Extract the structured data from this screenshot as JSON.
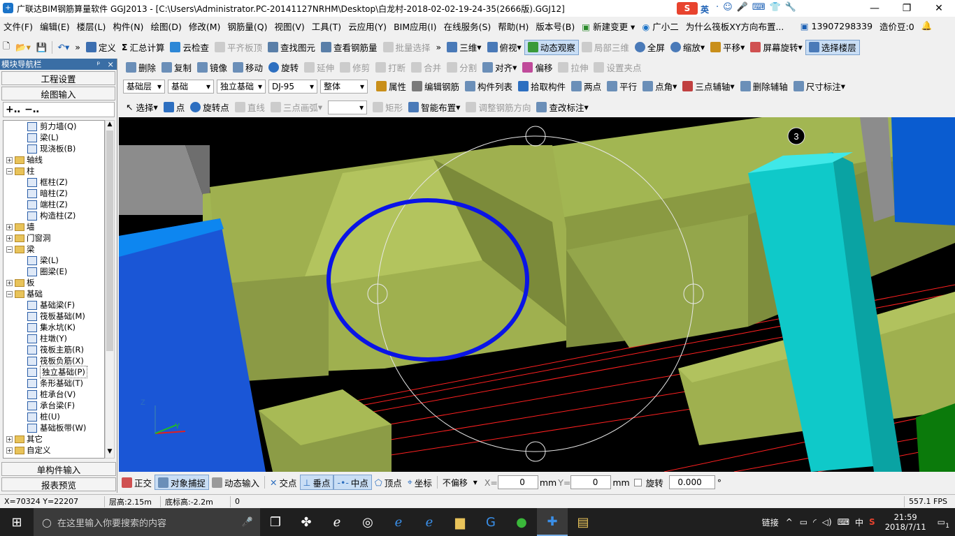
{
  "titlebar": {
    "title": "广联达BIM钢筋算量软件 GGJ2013 - [C:\\Users\\Administrator.PC-20141127NRHM\\Desktop\\白龙村-2018-02-02-19-24-35(2666版).GGJ12]",
    "ime_label": "英",
    "minimize": "—",
    "restore": "❐",
    "close": "✕"
  },
  "menubar": {
    "items": [
      "文件(F)",
      "编辑(E)",
      "楼层(L)",
      "构件(N)",
      "绘图(D)",
      "修改(M)",
      "钢筋量(Q)",
      "视图(V)",
      "工具(T)",
      "云应用(Y)",
      "BIM应用(I)",
      "在线服务(S)",
      "帮助(H)",
      "版本号(B)"
    ],
    "new_change": "新建变更",
    "assistant": "广小二",
    "question": "为什么筏板XY方向布置...",
    "phone": "13907298339",
    "price_beans": "造价豆:0"
  },
  "toolbar1": {
    "items": [
      "定义",
      "汇总计算",
      "云检查",
      "平齐板顶",
      "查找图元",
      "查看钢筋量",
      "批量选择"
    ],
    "view_items": [
      "三维",
      "俯视",
      "动态观察",
      "局部三维",
      "全屏",
      "缩放",
      "平移",
      "屏幕旋转",
      "选择楼层"
    ]
  },
  "toolbar2": {
    "items": [
      "删除",
      "复制",
      "镜像",
      "移动",
      "旋转",
      "延伸",
      "修剪",
      "打断",
      "合并",
      "分割",
      "对齐",
      "偏移",
      "拉伸",
      "设置夹点"
    ]
  },
  "toolbar3": {
    "floor": "基础层",
    "floor_sub": "基础",
    "component_type": "独立基础",
    "component_name": "DJ-95",
    "whole": "整体",
    "items": [
      "属性",
      "编辑钢筋",
      "构件列表",
      "拾取构件",
      "两点",
      "平行",
      "点角",
      "三点辅轴",
      "删除辅轴",
      "尺寸标注"
    ]
  },
  "toolbar4": {
    "items": [
      "选择",
      "点",
      "旋转点",
      "直线",
      "三点画弧",
      "矩形",
      "智能布置",
      "调整钢筋方向",
      "查改标注"
    ]
  },
  "leftpanel": {
    "header": "模块导航栏",
    "pin": "ᵖ",
    "close": "×",
    "btn_project": "工程设置",
    "btn_draw": "绘图输入",
    "btn_single": "单构件输入",
    "btn_report": "报表预览",
    "tree": [
      {
        "level": 2,
        "label": "剪力墙(Q)",
        "type": "comp"
      },
      {
        "level": 2,
        "label": "梁(L)",
        "type": "comp"
      },
      {
        "level": 2,
        "label": "现浇板(B)",
        "type": "comp"
      },
      {
        "level": 0,
        "label": "轴线",
        "type": "folder",
        "toggle": "+"
      },
      {
        "level": 0,
        "label": "柱",
        "type": "folder",
        "toggle": "-"
      },
      {
        "level": 2,
        "label": "框柱(Z)",
        "type": "comp"
      },
      {
        "level": 2,
        "label": "暗柱(Z)",
        "type": "comp"
      },
      {
        "level": 2,
        "label": "端柱(Z)",
        "type": "comp"
      },
      {
        "level": 2,
        "label": "构造柱(Z)",
        "type": "comp"
      },
      {
        "level": 0,
        "label": "墙",
        "type": "folder",
        "toggle": "+"
      },
      {
        "level": 0,
        "label": "门窗洞",
        "type": "folder",
        "toggle": "+"
      },
      {
        "level": 0,
        "label": "梁",
        "type": "folder",
        "toggle": "-"
      },
      {
        "level": 2,
        "label": "梁(L)",
        "type": "comp"
      },
      {
        "level": 2,
        "label": "圈梁(E)",
        "type": "comp"
      },
      {
        "level": 0,
        "label": "板",
        "type": "folder",
        "toggle": "+"
      },
      {
        "level": 0,
        "label": "基础",
        "type": "folder",
        "toggle": "-"
      },
      {
        "level": 2,
        "label": "基础梁(F)",
        "type": "comp"
      },
      {
        "level": 2,
        "label": "筏板基础(M)",
        "type": "comp"
      },
      {
        "level": 2,
        "label": "集水坑(K)",
        "type": "comp"
      },
      {
        "level": 2,
        "label": "柱墩(Y)",
        "type": "comp"
      },
      {
        "level": 2,
        "label": "筏板主筋(R)",
        "type": "comp"
      },
      {
        "level": 2,
        "label": "筏板负筋(X)",
        "type": "comp"
      },
      {
        "level": 2,
        "label": "独立基础(P)",
        "type": "comp",
        "selected": true
      },
      {
        "level": 2,
        "label": "条形基础(T)",
        "type": "comp"
      },
      {
        "level": 2,
        "label": "桩承台(V)",
        "type": "comp"
      },
      {
        "level": 2,
        "label": "承台梁(F)",
        "type": "comp"
      },
      {
        "level": 2,
        "label": "桩(U)",
        "type": "comp"
      },
      {
        "level": 2,
        "label": "基础板带(W)",
        "type": "comp"
      },
      {
        "level": 0,
        "label": "其它",
        "type": "folder",
        "toggle": "+"
      },
      {
        "level": 0,
        "label": "自定义",
        "type": "folder",
        "toggle": "+"
      }
    ]
  },
  "viewport": {
    "axis_label": "3",
    "axis_z": "Z",
    "axis_y": "Y"
  },
  "snapbar": {
    "items": [
      "正交",
      "对象捕捉",
      "动态输入",
      "交点",
      "垂点",
      "中点",
      "顶点",
      "坐标"
    ],
    "offset_mode": "不偏移",
    "x_label": "X=",
    "x_value": "0",
    "y_label": "Y=",
    "y_value": "0",
    "unit": "mm",
    "rotate_label": "旋转",
    "rotate_value": "0.000",
    "degree": "°"
  },
  "statusbar": {
    "coords": "X=70324 Y=22207",
    "floor_height": "层高:2.15m",
    "bottom_height": "底标高:-2.2m",
    "value": "0",
    "fps": "557.1 FPS"
  },
  "taskbar": {
    "search_placeholder": "在这里输入你要搜索的内容",
    "link": "链接",
    "lang": "中",
    "time": "21:59",
    "date": "2018/7/11",
    "notify": "1"
  }
}
